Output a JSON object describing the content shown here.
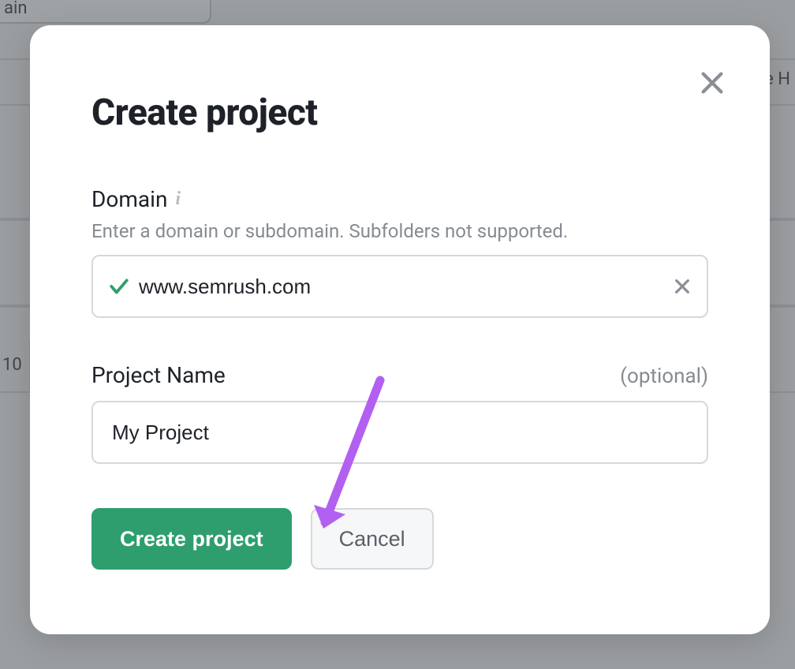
{
  "background": {
    "row_number": "10",
    "header_fragment": "e H",
    "input_fragment": "ain"
  },
  "modal": {
    "title": "Create project",
    "domain": {
      "label": "Domain",
      "help": "Enter a domain or subdomain. Subfolders not supported.",
      "value": "www.semrush.com"
    },
    "project_name": {
      "label": "Project Name",
      "optional": "(optional)",
      "value": "My Project"
    },
    "buttons": {
      "primary": "Create project",
      "secondary": "Cancel"
    }
  }
}
